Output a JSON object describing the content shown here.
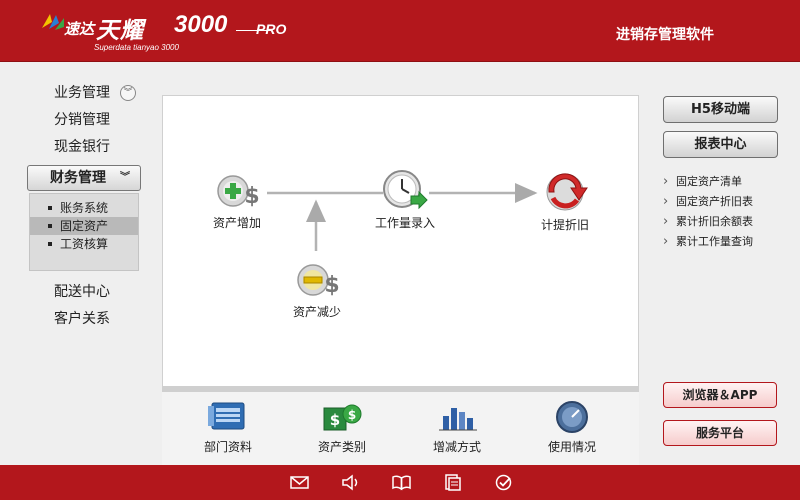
{
  "header": {
    "logo_cn_small": "速达",
    "logo_cn_big": "天耀",
    "logo_num": "3000",
    "logo_pro": "PRO",
    "logo_en": "Superdata tianyao 3000",
    "app_title": "进销存管理软件"
  },
  "leftnav": {
    "items_top": [
      {
        "label": "业务管理"
      },
      {
        "label": "分销管理"
      },
      {
        "label": "现金银行"
      }
    ],
    "active": {
      "label": "财务管理"
    },
    "submenu": [
      {
        "label": "账务系统"
      },
      {
        "label": "固定资产",
        "selected": true
      },
      {
        "label": "工资核算"
      }
    ],
    "items_bottom": [
      {
        "label": "配送中心"
      },
      {
        "label": "客户关系"
      }
    ]
  },
  "flow": {
    "asset_increase": "资产增加",
    "workload_entry": "工作量录入",
    "depreciation": "计提折旧",
    "asset_decrease": "资产减少"
  },
  "bottom": {
    "dept": "部门资料",
    "asset_category": "资产类别",
    "change_method": "增减方式",
    "usage": "使用情况"
  },
  "right": {
    "h5_button": "H5移动端",
    "report_button": "报表中心",
    "links": [
      {
        "label": "固定资产清单"
      },
      {
        "label": "固定资产折旧表"
      },
      {
        "label": "累计折旧余额表"
      },
      {
        "label": "累计工作量查询"
      }
    ],
    "browser_app": "浏览器＆APP",
    "service_platform": "服务平台"
  },
  "colors": {
    "brand_red": "#b3171c",
    "canvas_bg": "#ffffff",
    "page_bg": "#efefef"
  }
}
